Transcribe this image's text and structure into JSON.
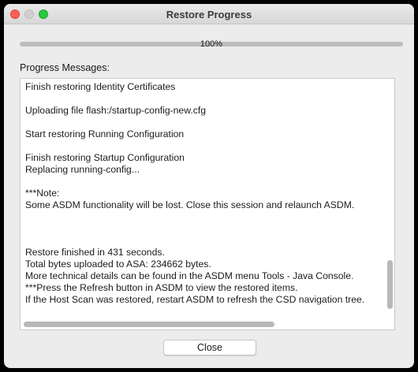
{
  "window": {
    "title": "Restore Progress"
  },
  "progress": {
    "value_percent": 100,
    "label": "100%"
  },
  "messages": {
    "label": "Progress Messages:",
    "lines": [
      "Finish restoring Identity Certificates",
      "",
      "Uploading file flash:/startup-config-new.cfg",
      "",
      "Start restoring Running Configuration",
      "",
      "Finish restoring Startup Configuration",
      "Replacing running-config...",
      "",
      "***Note:",
      "Some ASDM functionality will be lost. Close this session and relaunch ASDM.",
      "",
      "",
      "",
      "Restore finished in 431 seconds.",
      "Total bytes uploaded to ASA: 234662 bytes.",
      "More technical details can be found in the ASDM menu Tools - Java Console.",
      "***Press the Refresh button in ASDM to view the restored items.",
      "If the Host Scan was restored, restart ASDM to refresh the CSD navigation tree."
    ]
  },
  "buttons": {
    "close_label": "Close"
  },
  "colors": {
    "close_light": "#fe5f57",
    "minimize_light": "#d0d0d0",
    "maximize_light": "#28c840"
  }
}
